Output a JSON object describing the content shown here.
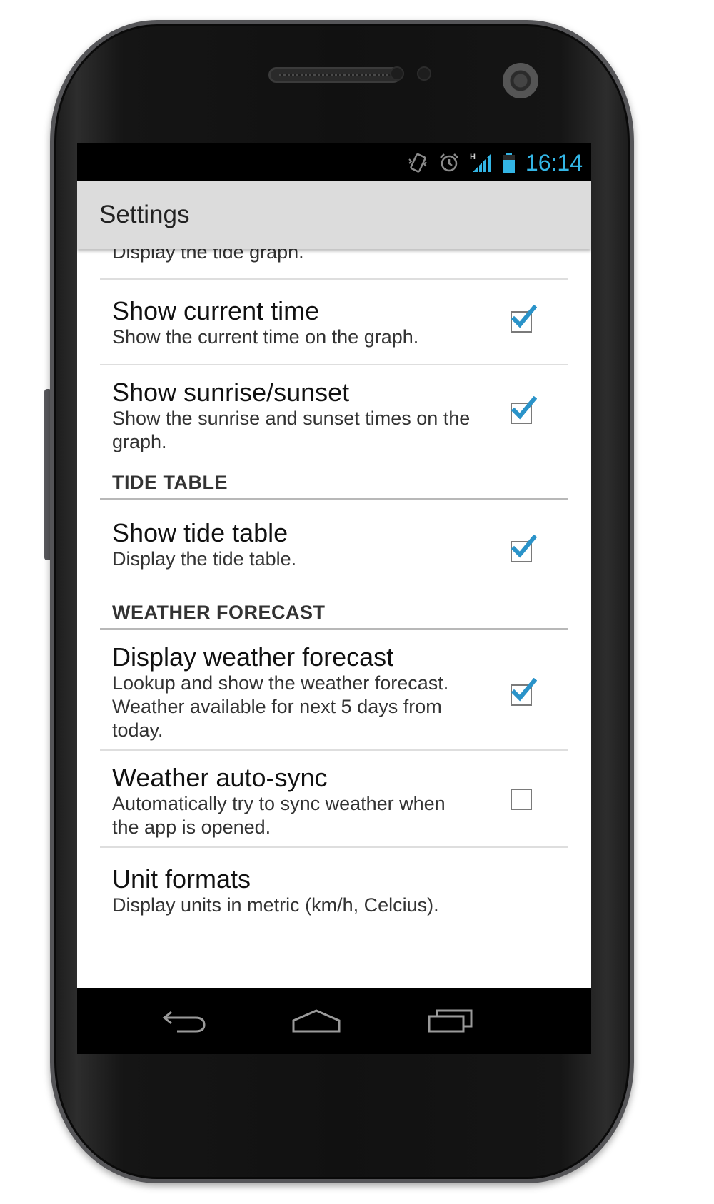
{
  "status_bar": {
    "time": "16:14",
    "icons": [
      "vibrate-icon",
      "alarm-icon",
      "signal-h-icon",
      "battery-icon"
    ],
    "accent_color": "#33b5e5"
  },
  "action_bar": {
    "title": "Settings"
  },
  "partial_item": {
    "summary": "Display the tide graph."
  },
  "items_graph": [
    {
      "title": "Show current time",
      "summary": "Show the current time on the graph.",
      "checked": true
    },
    {
      "title": "Show sunrise/sunset",
      "summary": "Show the sunrise and sunset times on the graph.",
      "checked": true
    }
  ],
  "sections": {
    "tide_table": {
      "header": "TIDE TABLE",
      "items": [
        {
          "title": "Show tide table",
          "summary": "Display the tide table.",
          "checked": true
        }
      ]
    },
    "weather": {
      "header": "WEATHER FORECAST",
      "items": [
        {
          "title": "Display weather forecast",
          "summary": "Lookup and show the weather forecast. Weather available for next 5 days from today.",
          "checked": true
        },
        {
          "title": "Weather auto-sync",
          "summary": "Automatically try to sync weather when the app is opened.",
          "checked": false
        },
        {
          "title": "Unit formats",
          "summary": "Display units in metric (km/h, Celcius)."
        }
      ]
    }
  },
  "nav_bar": {
    "buttons": [
      "back-icon",
      "home-icon",
      "recent-apps-icon"
    ]
  }
}
